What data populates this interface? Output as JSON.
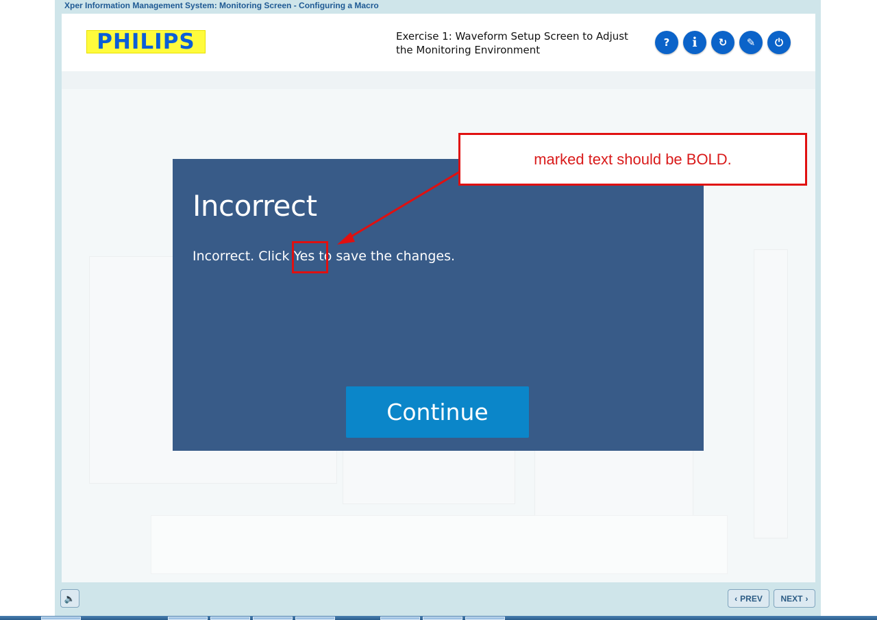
{
  "window": {
    "title": "Xper Information Management System: Monitoring Screen - Configuring a Macro"
  },
  "header": {
    "logo_text": "PHILIPS",
    "exercise_title_line1": "Exercise 1: Waveform Setup Screen to Adjust",
    "exercise_title_line2": "the Monitoring Environment",
    "buttons": [
      {
        "icon": "help-icon",
        "glyph": "?"
      },
      {
        "icon": "info-icon",
        "glyph": "i"
      },
      {
        "icon": "refresh-icon",
        "glyph": "↻"
      },
      {
        "icon": "compass-icon",
        "glyph": "✎"
      },
      {
        "icon": "power-icon",
        "glyph": "⏻"
      }
    ]
  },
  "dialog": {
    "title": "Incorrect",
    "message_before": "Incorrect. Click ",
    "message_bold": "Yes",
    "message_after": " to save the changes.",
    "continue_label": "Continue"
  },
  "annotation": {
    "text": "marked text should be BOLD.",
    "color": "#e01010"
  },
  "footer": {
    "prev_label": "PREV",
    "next_label": "NEXT"
  },
  "colors": {
    "dialog_bg": "#385b88",
    "continue_bg": "#0b86c9",
    "brand_blue": "#0b63c9"
  }
}
